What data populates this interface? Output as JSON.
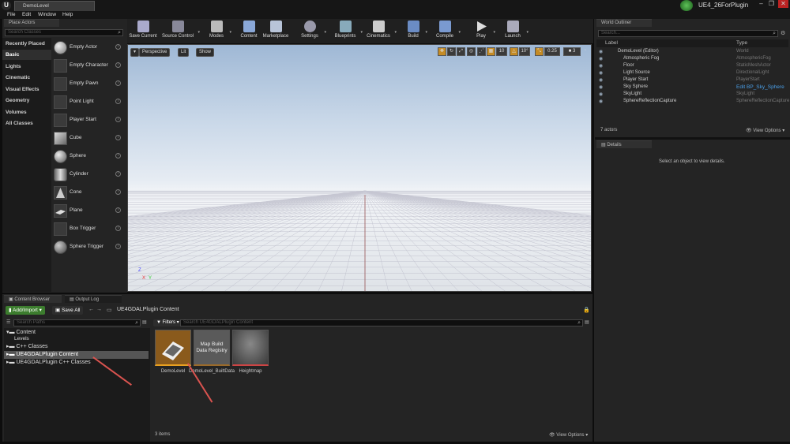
{
  "window": {
    "doc_tab": "DemoLevel",
    "project_name": "UE4_26ForPlugin",
    "logo": "U",
    "min": "–",
    "restore": "❐",
    "close": "✕"
  },
  "menu": [
    "File",
    "Edit",
    "Window",
    "Help"
  ],
  "place_actors": {
    "tab_label": "Place Actors",
    "search_placeholder": "Search Classes",
    "categories": [
      "Recently Placed",
      "Basic",
      "Lights",
      "Cinematic",
      "Visual Effects",
      "Geometry",
      "Volumes",
      "All Classes"
    ],
    "selected_category": "Basic",
    "items": [
      "Empty Actor",
      "Empty Character",
      "Empty Pawn",
      "Point Light",
      "Player Start",
      "Cube",
      "Sphere",
      "Cylinder",
      "Cone",
      "Plane",
      "Box Trigger",
      "Sphere Trigger"
    ]
  },
  "toolbar": [
    "Save Current",
    "Source Control",
    "Modes",
    "Content",
    "Marketplace",
    "Settings",
    "Blueprints",
    "Cinematics",
    "Build",
    "Compile",
    "Play",
    "Launch"
  ],
  "viewport": {
    "perspective": "Perspective",
    "lit": "Lit",
    "show": "Show",
    "snap_grid": "10",
    "snap_rot": "10°",
    "snap_scale": "0.25",
    "cam_speed": "3",
    "axis_z": "Z",
    "axis_x": "X",
    "axis_y": "Y"
  },
  "outliner": {
    "tab_label": "World Outliner",
    "search_placeholder": "Search...",
    "col_label": "Label",
    "col_type": "Type",
    "rows": [
      {
        "label": "DemoLevel (Editor)",
        "type": "World"
      },
      {
        "label": "Atmospheric Fog",
        "type": "AtmosphericFog"
      },
      {
        "label": "Floor",
        "type": "StaticMeshActor"
      },
      {
        "label": "Light Source",
        "type": "DirectionalLight"
      },
      {
        "label": "Player Start",
        "type": "PlayerStart"
      },
      {
        "label": "Sky Sphere",
        "type": "Edit BP_Sky_Sphere"
      },
      {
        "label": "SkyLight",
        "type": "SkyLight"
      },
      {
        "label": "SphereReflectionCapture",
        "type": "SphereReflectionCapture"
      }
    ],
    "count": "7 actors",
    "view_options": "View Options"
  },
  "details": {
    "tab_label": "Details",
    "empty_msg": "Select an object to view details."
  },
  "content_browser": {
    "tab_label": "Content Browser",
    "output_tab": "Output Log",
    "add_import": "Add/Import",
    "save_all": "Save All",
    "path": "UE4GDALPlugin Content",
    "search_paths": "Search Paths",
    "filters": "Filters",
    "search_assets": "Search UE4GDALPlugin Content",
    "tree": [
      "Content",
      "Levels",
      "C++ Classes",
      "UE4GDALPlugin Content",
      "UE4GDALPlugin C++ Classes"
    ],
    "assets": [
      {
        "name": "DemoLevel",
        "thumb_text": ""
      },
      {
        "name": "DemoLevel_BuiltData",
        "thumb_text": "Map Build Data Registry"
      },
      {
        "name": "Heightmap",
        "thumb_text": ""
      }
    ],
    "item_count": "3 items",
    "view_options": "View Options"
  }
}
